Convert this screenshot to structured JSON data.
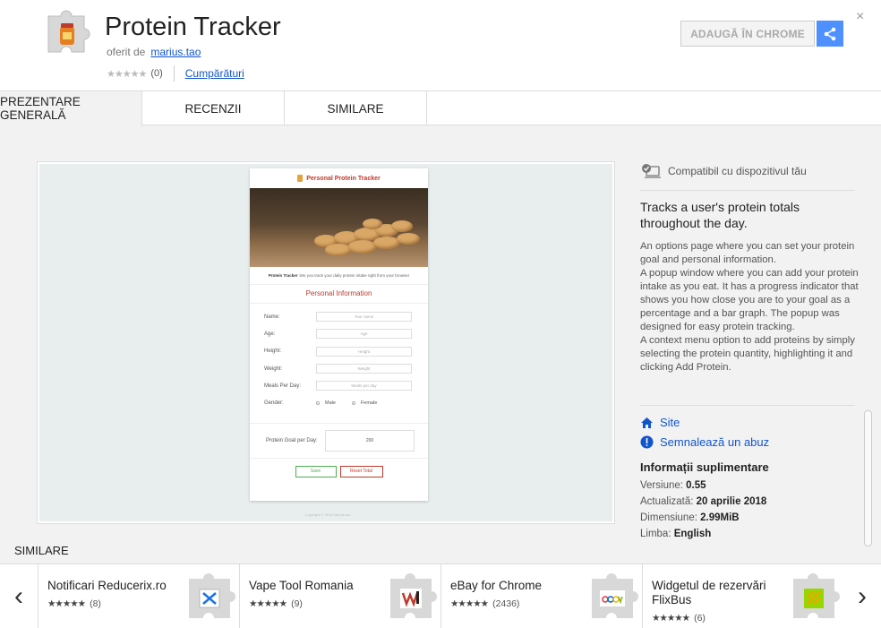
{
  "header": {
    "title": "Protein Tracker",
    "offered_by_label": "oferit de",
    "offered_by_author": "marius.tao",
    "stars": "★★★★★",
    "rating_count": "(0)",
    "category": "Cumpărături",
    "add_button_label": "ADAUGĂ ÎN CHROME",
    "share_icon": "share-icon",
    "close_label": "×"
  },
  "tabs": [
    {
      "label": "PREZENTARE GENERALĂ",
      "active": true
    },
    {
      "label": "RECENZII",
      "active": false
    },
    {
      "label": "SIMILARE",
      "active": false
    }
  ],
  "preview": {
    "app_title": "Personal Protein Tracker",
    "tagline_bold": "Protein Tracker",
    "tagline": "lets you track your daily protein intake right from your browser",
    "section_title": "Personal Information",
    "fields": [
      {
        "label": "Name:",
        "placeholder": "Your name"
      },
      {
        "label": "Age:",
        "placeholder": "Age"
      },
      {
        "label": "Height:",
        "placeholder": "Height"
      },
      {
        "label": "Weight:",
        "placeholder": "Weight"
      },
      {
        "label": "Meals Per Day:",
        "placeholder": "Meals per day"
      }
    ],
    "gender_label": "Gender:",
    "gender_male": "Male",
    "gender_female": "Female",
    "goal_label": "Protein Goal per Day:",
    "goal_value": "200",
    "save_label": "Save",
    "reset_label": "Reset Total",
    "copyright": "Copyright © 2018 Marius.tao"
  },
  "sidebar": {
    "compatible": "Compatibil cu dispozitivul tău",
    "summary": "Tracks a user's protein totals throughout the day.",
    "description": "An options page where you can set your protein goal and personal information.\nA popup window where you can add your protein intake as you eat. It has a progress indicator that shows you how close you are to your goal as a percentage and a bar graph. The popup was designed for easy protein tracking.\nA context menu option to add proteins by simply selecting the protein quantity, highlighting it and clicking Add Protein.",
    "site_label": "Site",
    "report_label": "Semnalează un abuz",
    "info_title": "Informații suplimentare",
    "version_label": "Versiune:",
    "version_value": "0.55",
    "updated_label": "Actualizată:",
    "updated_value": "20 aprilie 2018",
    "size_label": "Dimensiune:",
    "size_value": "2.99MiB",
    "language_label": "Limba:",
    "language_value": "English"
  },
  "similar": {
    "title": "SIMILARE",
    "prev_label": "‹",
    "next_label": "›",
    "items": [
      {
        "name": "Notificari Reducerix.ro",
        "stars": "★★★★★",
        "count": "(8)",
        "icon": "reducerix-icon"
      },
      {
        "name": "Vape Tool Romania",
        "stars": "★★★★★",
        "count": "(9)",
        "icon": "vape-tool-icon"
      },
      {
        "name": "eBay for Chrome",
        "stars": "★★★★★",
        "count": "(2436)",
        "icon": "ebay-icon"
      },
      {
        "name": "Widgetul de rezervări FlixBus",
        "stars": "★★★★★",
        "count": "(6)",
        "icon": "flixbus-icon"
      }
    ]
  }
}
